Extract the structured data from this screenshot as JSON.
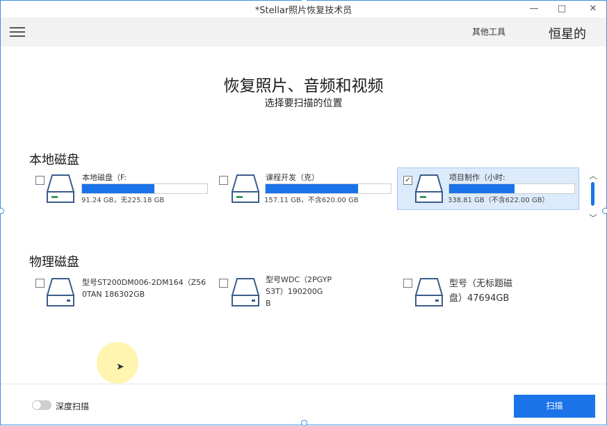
{
  "window": {
    "title": "*Stellar照片恢复技术员",
    "minimize": "—",
    "maximize": "□",
    "close": "✕"
  },
  "toolbar": {
    "menu_icon": "hamburger-menu-icon",
    "other_tools": "其他工具",
    "overlay_text": "恒星的"
  },
  "heading": "恢复照片、音频和视频",
  "subheading": "选择要扫描的位置",
  "local_section": {
    "title": "本地磁盘",
    "drives": [
      {
        "label": "本地磁盘（F:",
        "size": "91.24 GB，无225.18 GB",
        "checked": false,
        "fill": 0.58
      },
      {
        "label": "课程开发（克）",
        "size": "157.11 GB，不含620.00 GB",
        "checked": false,
        "fill": 0.74
      },
      {
        "label": "项目制作（小时:",
        "size": "338.81 GB（不含622.00 GB）",
        "checked": true,
        "check_mark": "✓",
        "fill": 0.52
      }
    ]
  },
  "physical_section": {
    "title": "物理磁盘",
    "drives": [
      {
        "line1": "型号ST200DM006-2DM164（Z56",
        "line2": "0TAN 186302GB",
        "checked": false
      },
      {
        "line1": "型号WDC（2PGYP",
        "line2": "S3T）190200G",
        "line3": "B",
        "checked": false
      },
      {
        "line1": "型号（无标题磁",
        "line2": "盘）47694GB",
        "checked": false
      }
    ]
  },
  "scrollbar": {
    "up": "︿",
    "down": "﹀"
  },
  "footer": {
    "deep_scan_label": "深度扫描",
    "deep_scan_on": false,
    "scan_button": "扫描"
  },
  "colors": {
    "accent": "#1a73e8",
    "selected_bg": "#dcebfb",
    "toolbar_bg": "#f2f2f2"
  }
}
